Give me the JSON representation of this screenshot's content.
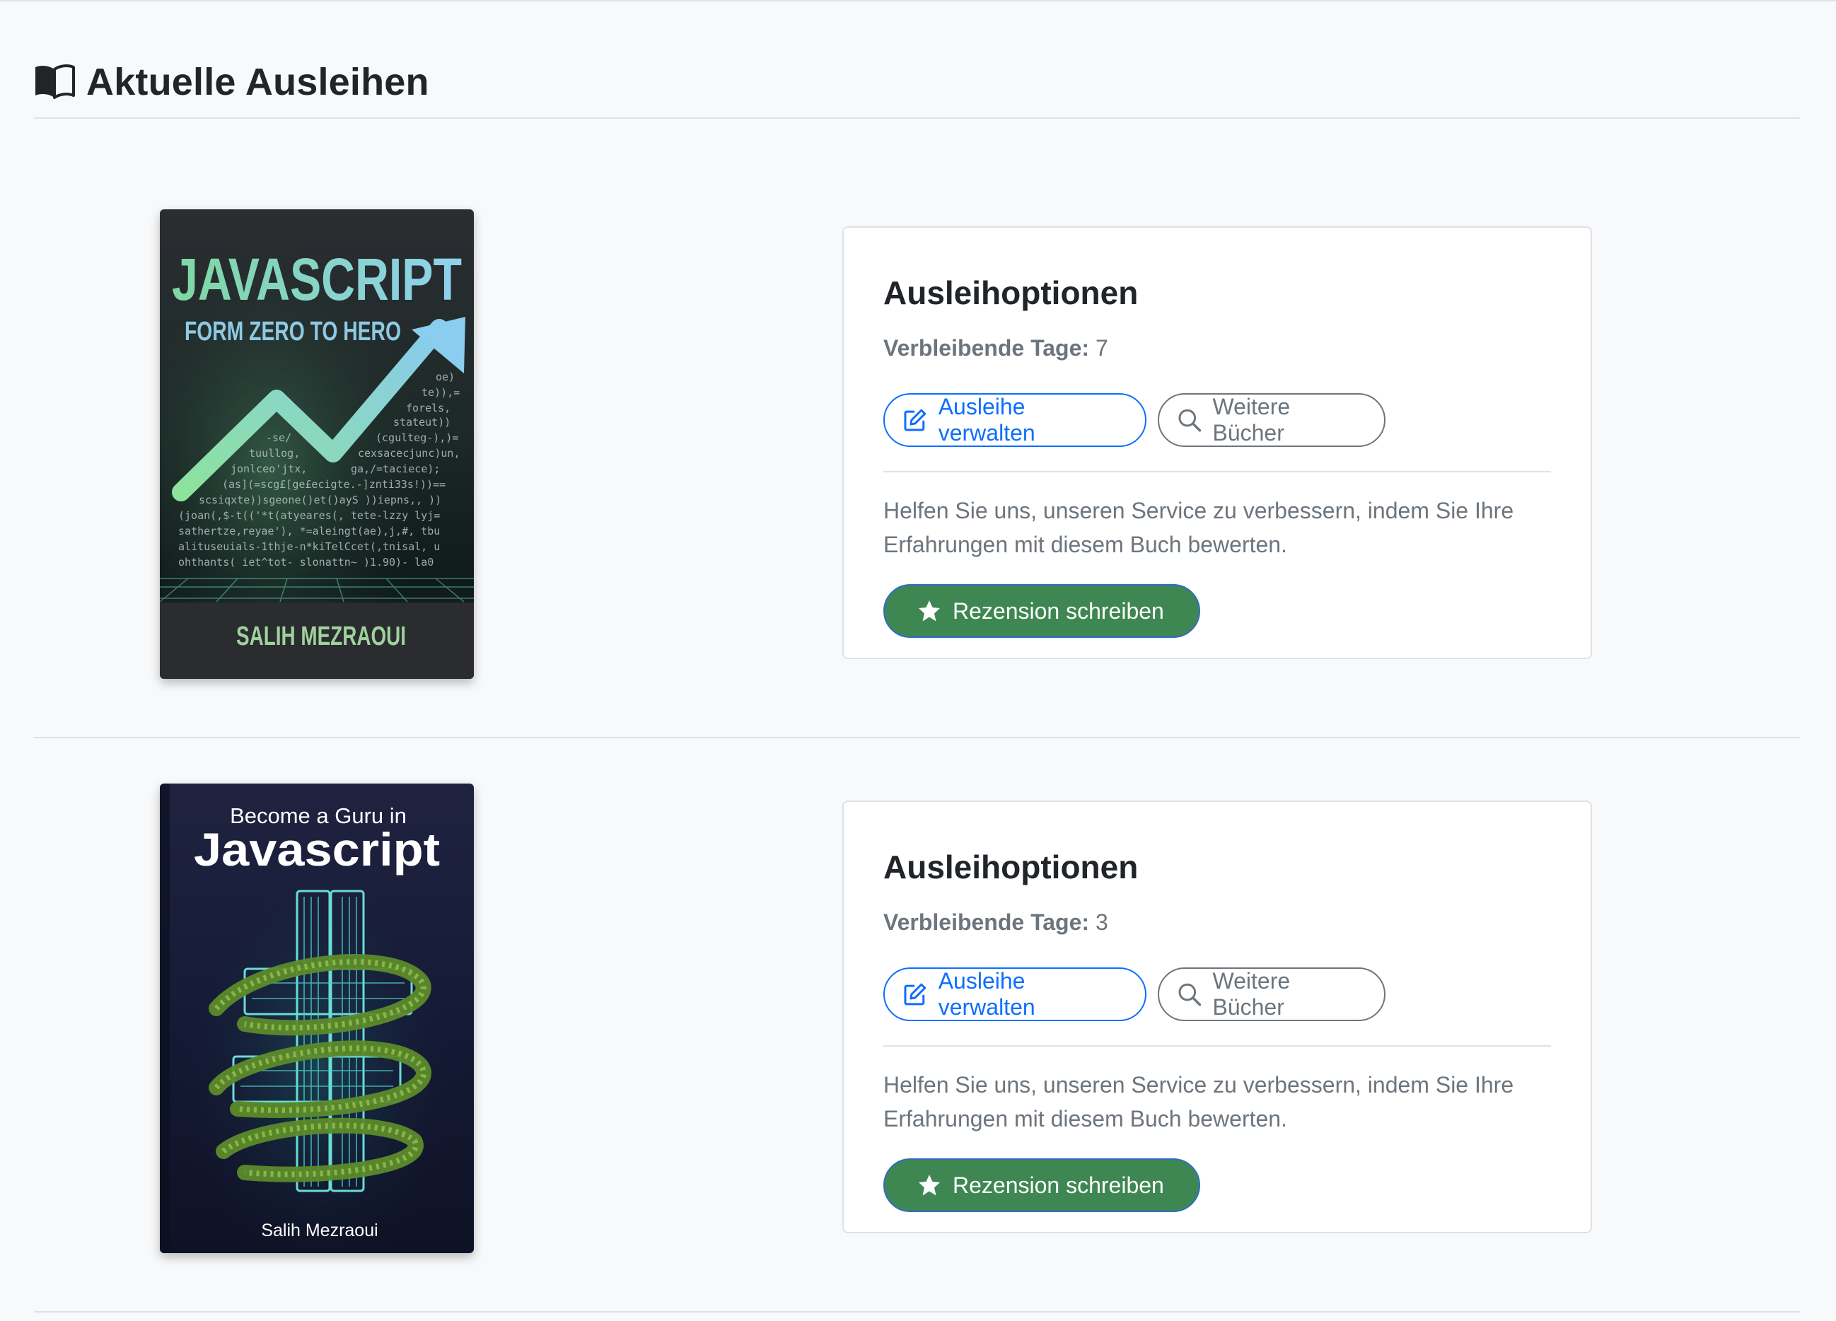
{
  "page": {
    "title": "Aktuelle Ausleihen",
    "title_icon": "book-open-icon"
  },
  "colors": {
    "primary": "#0d6efd",
    "secondary": "#6c757d",
    "success": "#3f8752",
    "border": "#dee2e6",
    "background": "#f8f9fa"
  },
  "loans": [
    {
      "cover": {
        "title_main": "JAVASCRIPT",
        "subtitle": "FORM ZERO TO HERO",
        "author": "SALIH MEZRAOUI"
      },
      "card": {
        "title": "Ausleihoptionen",
        "days_label": "Verbleibende Tage:",
        "days_value": "7",
        "manage_label": "Ausleihe verwalten",
        "manage_icon": "pencil-square-icon",
        "more_label": "Weitere Bücher",
        "more_icon": "search-icon",
        "help_text": "Helfen Sie uns, unseren Service zu verbessern, indem Sie Ihre Erfahrungen mit diesem Buch bewerten.",
        "review_label": "Rezension schreiben",
        "review_icon": "star-icon"
      }
    },
    {
      "cover": {
        "title_top": "Become a Guru in",
        "title_main": "Javascript",
        "author": "Salih Mezraoui"
      },
      "card": {
        "title": "Ausleihoptionen",
        "days_label": "Verbleibende Tage:",
        "days_value": "3",
        "manage_label": "Ausleihe verwalten",
        "manage_icon": "pencil-square-icon",
        "more_label": "Weitere Bücher",
        "more_icon": "search-icon",
        "help_text": "Helfen Sie uns, unseren Service zu verbessern, indem Sie Ihre Erfahrungen mit diesem Buch bewerten.",
        "review_label": "Rezension schreiben",
        "review_icon": "star-icon"
      }
    }
  ]
}
